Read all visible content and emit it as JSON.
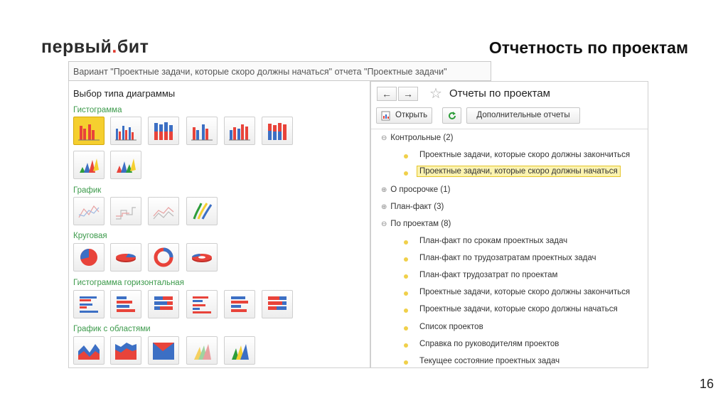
{
  "brand": {
    "logo_pre": "первый",
    "logo_post": "бит"
  },
  "slide": {
    "title": "Отчетность по проектам",
    "page_number": "16"
  },
  "variant_bar": {
    "text": "Вариант \"Проектные задачи, которые скоро должны начаться\" отчета \"Проектные задачи\""
  },
  "left_panel": {
    "title": "Выбор типа диаграммы",
    "sections": [
      {
        "label": "Гистограмма",
        "count": 8
      },
      {
        "label": "График",
        "count": 4
      },
      {
        "label": "Круговая",
        "count": 4
      },
      {
        "label": "Гистограмма горизонтальная",
        "count": 6
      },
      {
        "label": "График с областями",
        "count": 5
      }
    ],
    "selected": "Гистограмма #1"
  },
  "right_panel": {
    "back_icon": "arrow-left-icon",
    "forward_icon": "arrow-right-icon",
    "favorite_icon": "star-icon",
    "title": "Отчеты по проектам",
    "buttons": {
      "open": "Открыть",
      "refresh_icon": "refresh-icon",
      "additional": "Дополнительные отчеты"
    },
    "tree": {
      "groups": [
        {
          "label": "Контрольные (2)",
          "expanded": true,
          "items": [
            {
              "label": "Проектные задачи, которые скоро должны закончиться",
              "selected": false
            },
            {
              "label": "Проектные задачи, которые скоро должны начаться",
              "selected": true
            }
          ]
        },
        {
          "label": "О просрочке (1)",
          "expanded": false
        },
        {
          "label": "План-факт (3)",
          "expanded": false
        },
        {
          "label": "По проектам (8)",
          "expanded": true,
          "items": [
            {
              "label": "План-факт по срокам проектных задач"
            },
            {
              "label": "План-факт по трудозатратам проектных задач"
            },
            {
              "label": "План-факт трудозатрат по проектам"
            },
            {
              "label": "Проектные задачи, которые скоро должны закончиться"
            },
            {
              "label": "Проектные задачи, которые скоро должны начаться"
            },
            {
              "label": "Список проектов"
            },
            {
              "label": "Справка по руководителям проектов"
            },
            {
              "label": "Текущее состояние проектных задач"
            }
          ]
        }
      ]
    }
  },
  "colors": {
    "accent_red": "#e8433a",
    "accent_blue": "#3c6fc4",
    "selected_yellow": "#f5cf2f",
    "section_green": "#3c9a4b"
  }
}
